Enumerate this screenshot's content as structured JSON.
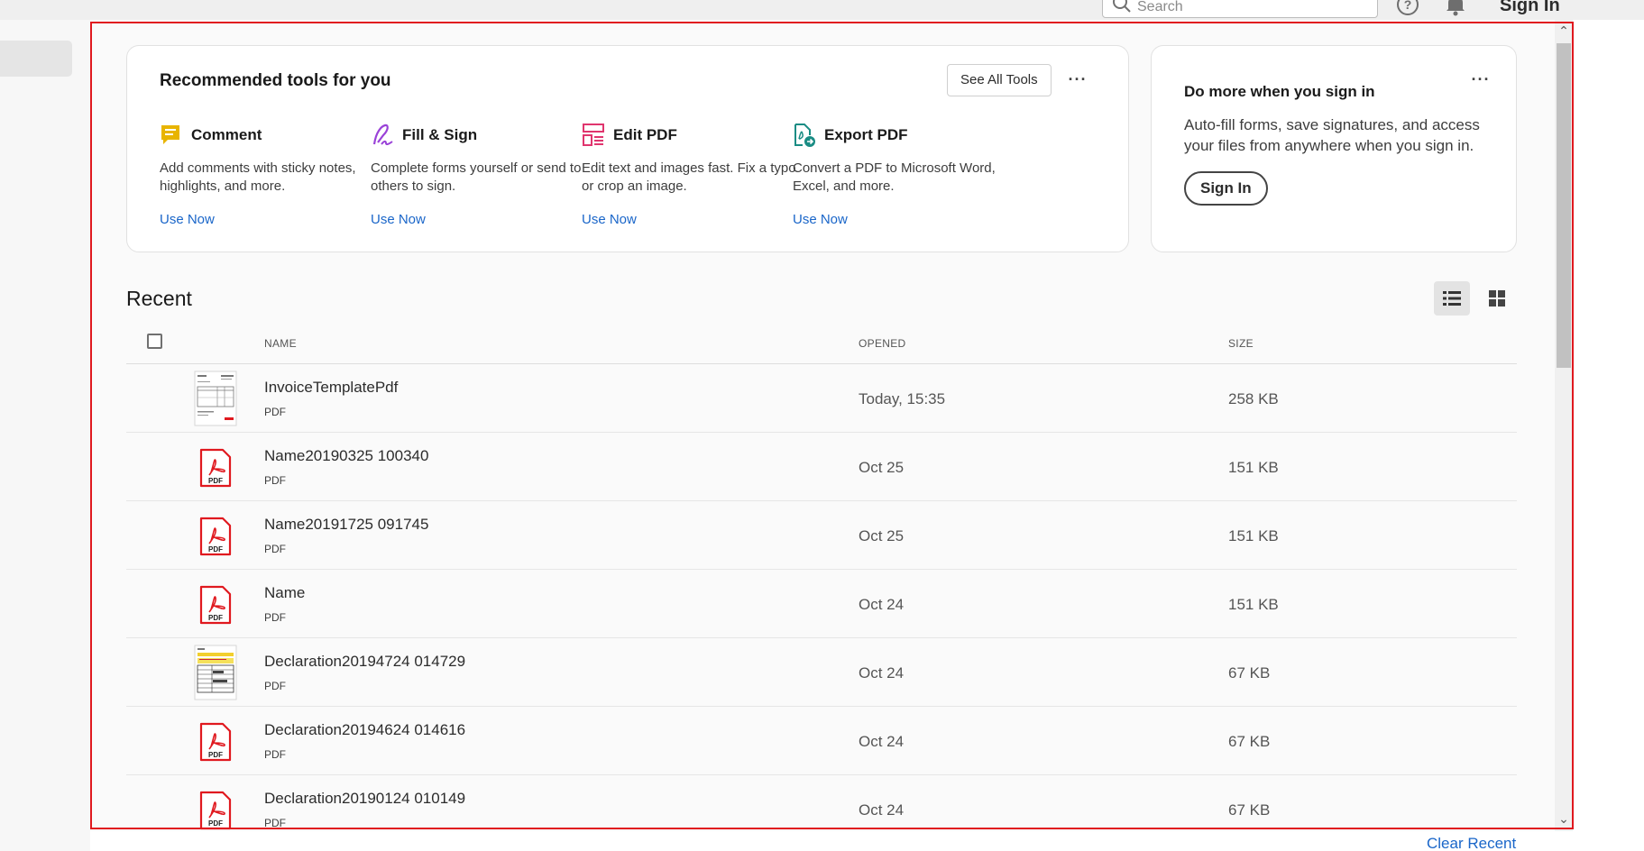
{
  "topbar": {
    "search_placeholder": "Search",
    "search_icon": "search-icon",
    "help_icon": "help-icon",
    "notifications_icon": "bell-icon",
    "sign_in_label": "Sign In"
  },
  "recommended": {
    "title": "Recommended tools for you",
    "see_all_label": "See All Tools",
    "more_label": "···",
    "tools": [
      {
        "name": "Comment",
        "icon": "comment-icon",
        "color": "#e8b400",
        "description": "Add comments with sticky notes, highlights, and more.",
        "link": "Use Now"
      },
      {
        "name": "Fill & Sign",
        "icon": "fill-sign-icon",
        "color": "#9a42d8",
        "description": "Complete forms yourself or send to others to sign.",
        "link": "Use Now"
      },
      {
        "name": "Edit PDF",
        "icon": "edit-pdf-icon",
        "color": "#e0356e",
        "description": "Edit text and images fast. Fix a typo or crop an image.",
        "link": "Use Now"
      },
      {
        "name": "Export PDF",
        "icon": "export-pdf-icon",
        "color": "#1a8c84",
        "description": "Convert a PDF to Microsoft Word, Excel, and more.",
        "link": "Use Now"
      }
    ]
  },
  "sign_in_card": {
    "title": "Do more when you sign in",
    "description": "Auto-fill forms, save signatures, and access your files from anywhere when you sign in.",
    "button_label": "Sign In",
    "more_label": "···"
  },
  "recent": {
    "title": "Recent",
    "columns": {
      "name": "NAME",
      "opened": "OPENED",
      "size": "SIZE"
    },
    "files": [
      {
        "name": "InvoiceTemplatePdf",
        "type": "PDF",
        "opened": "Today, 15:35",
        "size": "258 KB",
        "thumbnail": "invoice-thumbnail"
      },
      {
        "name": "Name20190325 100340",
        "type": "PDF",
        "opened": "Oct 25",
        "size": "151 KB",
        "thumbnail": "pdf-file-icon"
      },
      {
        "name": "Name20191725 091745",
        "type": "PDF",
        "opened": "Oct 25",
        "size": "151 KB",
        "thumbnail": "pdf-file-icon"
      },
      {
        "name": "Name",
        "type": "PDF",
        "opened": "Oct 24",
        "size": "151 KB",
        "thumbnail": "pdf-file-icon"
      },
      {
        "name": "Declaration20194724 014729",
        "type": "PDF",
        "opened": "Oct 24",
        "size": "67 KB",
        "thumbnail": "declaration-thumbnail"
      },
      {
        "name": "Declaration20194624 014616",
        "type": "PDF",
        "opened": "Oct 24",
        "size": "67 KB",
        "thumbnail": "pdf-file-icon"
      },
      {
        "name": "Declaration20190124 010149",
        "type": "PDF",
        "opened": "Oct 24",
        "size": "67 KB",
        "thumbnail": "pdf-file-icon"
      }
    ],
    "clear_label": "Clear Recent"
  },
  "colors": {
    "link": "#1a66c9",
    "highlight_border": "#e0191f",
    "pdf_red": "#e0191f"
  }
}
